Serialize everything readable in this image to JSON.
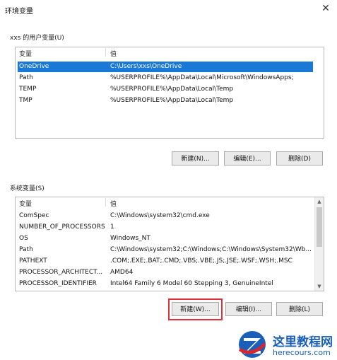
{
  "window": {
    "title": "环境变量",
    "close_glyph": "✕"
  },
  "user_vars": {
    "group_label": "xxs 的用户变量(U)",
    "col_name": "变量",
    "col_value": "值",
    "rows": [
      {
        "name": "OneDrive",
        "value": "C:\\Users\\xxs\\OneDrive",
        "selected": true
      },
      {
        "name": "Path",
        "value": "%USERPROFILE%\\AppData\\Local\\Microsoft\\WindowsApps;"
      },
      {
        "name": "TEMP",
        "value": "%USERPROFILE%\\AppData\\Local\\Temp"
      },
      {
        "name": "TMP",
        "value": "%USERPROFILE%\\AppData\\Local\\Temp"
      }
    ],
    "buttons": {
      "new": "新建(N)...",
      "edit": "编辑(E)...",
      "delete": "删除(D)"
    }
  },
  "system_vars": {
    "group_label": "系统变量(S)",
    "col_name": "变量",
    "col_value": "值",
    "rows": [
      {
        "name": "ComSpec",
        "value": "C:\\Windows\\system32\\cmd.exe"
      },
      {
        "name": "NUMBER_OF_PROCESSORS",
        "value": "1"
      },
      {
        "name": "OS",
        "value": "Windows_NT"
      },
      {
        "name": "Path",
        "value": "C:\\Windows\\system32;C:\\Windows;C:\\Windows\\System32\\Wb..."
      },
      {
        "name": "PATHEXT",
        "value": ".COM;.EXE;.BAT;.CMD;.VBS;.VBE;.JS;.JSE;.WSF;.WSH;.MSC"
      },
      {
        "name": "PROCESSOR_ARCHITECT...",
        "value": "AMD64"
      },
      {
        "name": "PROCESSOR_IDENTIFIER",
        "value": "Intel64 Family 6 Model 60 Stepping 3, GenuineIntel"
      }
    ],
    "buttons": {
      "new": "新建(W)...",
      "edit": "编辑(I)...",
      "delete": "删除(L)"
    },
    "scroll_up_glyph": "▲",
    "scroll_down_glyph": "▼"
  },
  "watermark": {
    "title": "这里教程网",
    "url": "herecours.com",
    "colors": {
      "blue": "#1b5fb8",
      "red": "#d8262e"
    }
  },
  "colors": {
    "selection": "#1a78d6",
    "highlight": "#e0303a"
  }
}
